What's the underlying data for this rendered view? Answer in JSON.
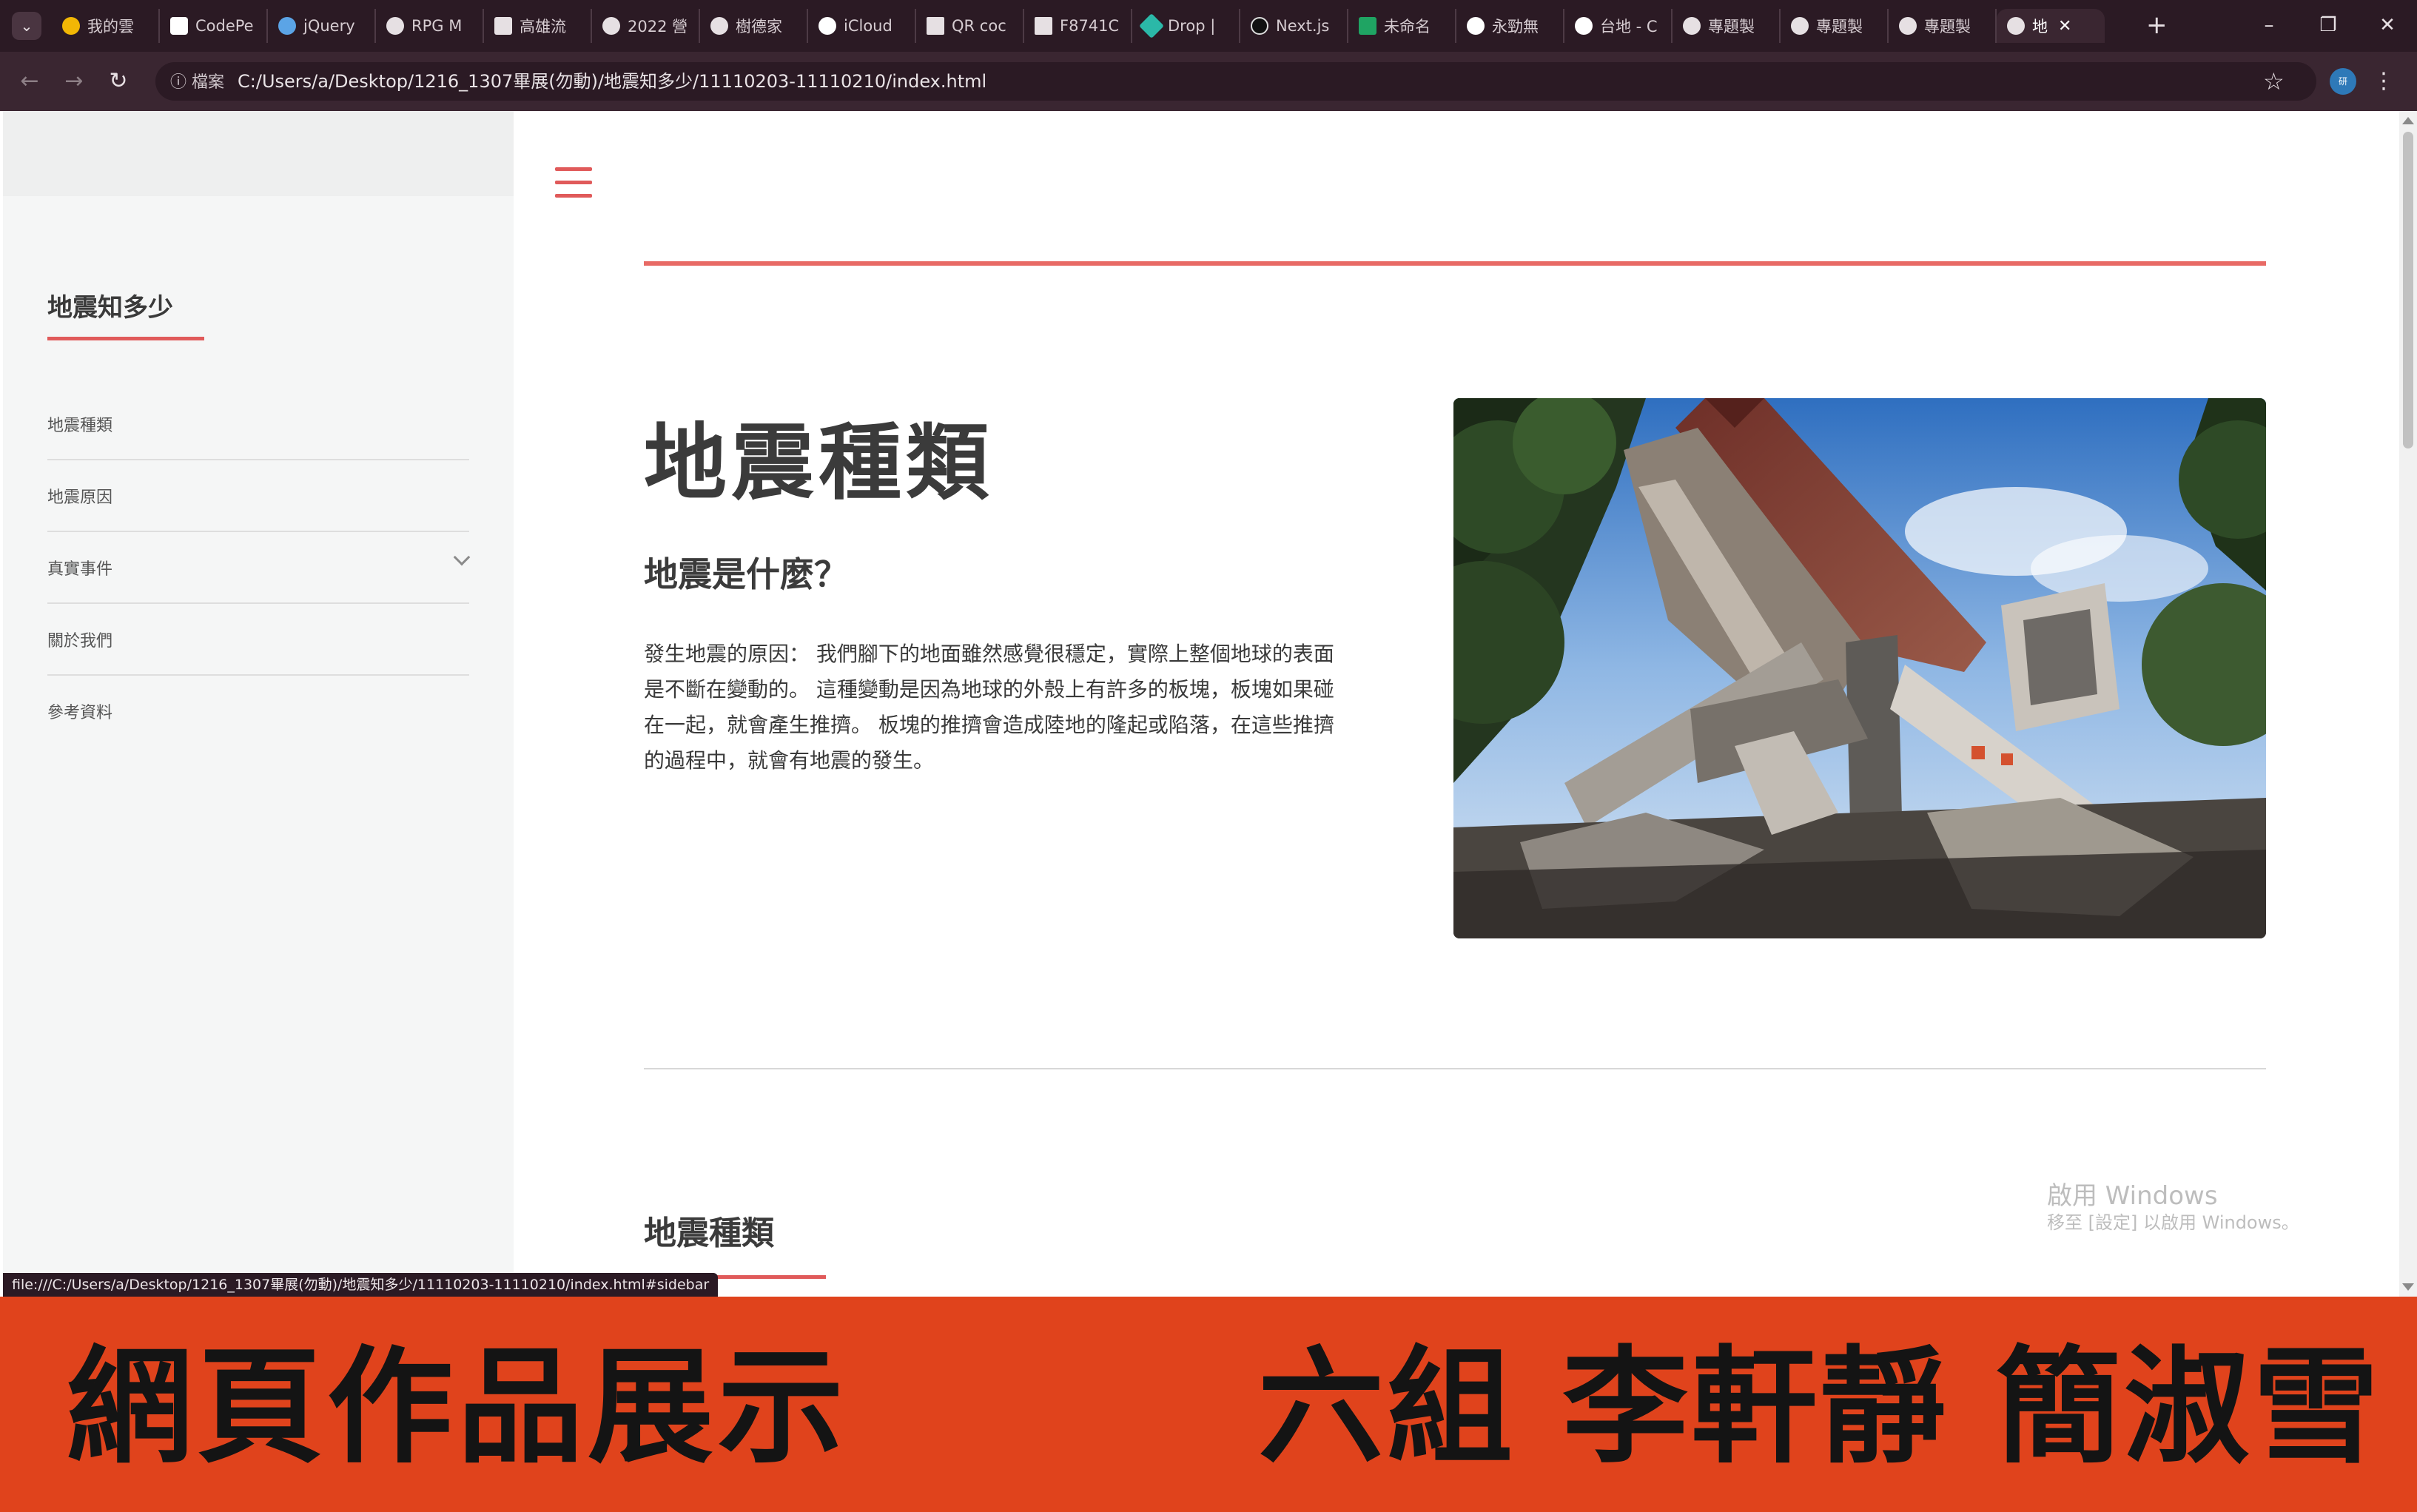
{
  "browser": {
    "tabs": [
      {
        "label": "我的雲"
      },
      {
        "label": "CodePe"
      },
      {
        "label": "jQuery"
      },
      {
        "label": "RPG M"
      },
      {
        "label": "高雄流"
      },
      {
        "label": "2022 營"
      },
      {
        "label": "樹德家"
      },
      {
        "label": "iCloud"
      },
      {
        "label": "QR coc"
      },
      {
        "label": "F8741C"
      },
      {
        "label": "Drop |"
      },
      {
        "label": "Next.js"
      },
      {
        "label": "未命名"
      },
      {
        "label": "永勁無"
      },
      {
        "label": "台地 - C"
      },
      {
        "label": "專題製"
      },
      {
        "label": "專題製"
      },
      {
        "label": "專題製"
      },
      {
        "label": "地"
      }
    ],
    "site_chip": "檔案",
    "address": "C:/Users/a/Desktop/1216_1307畢展(勿動)/地震知多少/11110203-11110210/index.html",
    "profile_label": "研",
    "status_url": "file:///C:/Users/a/Desktop/1216_1307畢展(勿動)/地震知多少/11110203-11110210/index.html#sidebar"
  },
  "sidebar": {
    "title": "地震知多少",
    "items": [
      {
        "label": "地震種類"
      },
      {
        "label": "地震原因"
      },
      {
        "label": "真實事件"
      },
      {
        "label": "關於我們"
      },
      {
        "label": "參考資料"
      }
    ]
  },
  "main": {
    "title": "地震種類",
    "subheading": "地震是什麼？",
    "intro": "發生地震的原因： 我們腳下的地面雖然感覺很穩定，實際上整個地球的表面是不斷在變動的。 這種變動是因為地球的外殼上有許多的板塊，板塊如果碰在一起，就會產生推擠。 板塊的推擠會造成陸地的隆起或陷落，在這些推擠的過程中，就會有地震的發生。",
    "section_heading": "地震種類"
  },
  "watermark": {
    "line1": "啟用 Windows",
    "line2": "移至 [設定] 以啟用 Windows。"
  },
  "banner": {
    "left": "網頁作品展示",
    "right": "六組  李軒靜  簡淑雪"
  },
  "colors": {
    "accent": "#e05a5a",
    "banner": "#e0431c",
    "chrome": "#3a2631"
  }
}
